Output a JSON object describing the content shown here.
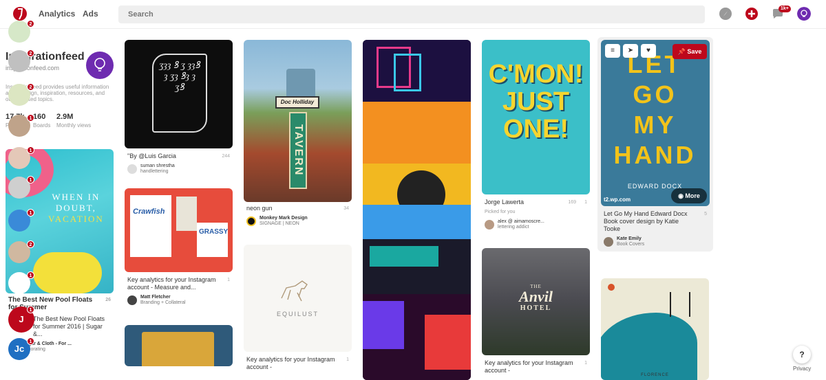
{
  "topbar": {
    "nav": [
      "Analytics",
      "Ads"
    ],
    "search_placeholder": "Search",
    "messages_badge": "1k+"
  },
  "profile": {
    "name": "Inspirationfeed",
    "url": "inspirationfeed.com",
    "description": "Inspirationfeed provides useful information about design, inspiration, resources, and other related topics.",
    "stats": [
      {
        "value": "17.7k",
        "label": "Pins"
      },
      {
        "value": "160",
        "label": "Boards"
      },
      {
        "value": "2.9M",
        "label": "Monthly views"
      }
    ]
  },
  "notifications": [
    {
      "badge": "2"
    },
    {
      "badge": "2"
    },
    {
      "badge": "2"
    },
    {
      "badge": "1"
    },
    {
      "badge": "1"
    },
    {
      "badge": "1"
    },
    {
      "badge": "1"
    },
    {
      "badge": "2"
    },
    {
      "badge": "1"
    },
    {
      "badge": "1",
      "letter": "J"
    },
    {
      "badge": "1",
      "letter": "Jc"
    }
  ],
  "pins": {
    "col0": [
      {
        "title": "The Best New Pool Floats for Summer",
        "repins": "26",
        "desc": "The Best New Pool Floats for Summer 2016 | Sugar &...",
        "user": "Sugar & Cloth - For ...",
        "board": "Decorating"
      }
    ],
    "col1": [
      {
        "title": "\"By @Luis Garcia",
        "repins": "244",
        "user": "suman shrestha",
        "board": "handlettering"
      },
      {
        "title": "Key analytics for your Instagram account - Measure and...",
        "repins": "1",
        "user": "Matt Fletcher",
        "board": "Branding + Collateral"
      }
    ],
    "col2": [
      {
        "title": "neon gun",
        "repins": "34",
        "user": "Monkey Mark Design",
        "board": "SIGNAGE | NEON",
        "sign_top": "Doc Holliday",
        "sign_main": "TAVERN"
      },
      {
        "title": "Key analytics for your Instagram account -",
        "repins": "1",
        "img_text": "EQUILUST"
      }
    ],
    "col3": [
      {
        "title": ""
      }
    ],
    "col4": [
      {
        "title": "Jorge Lawerta",
        "repins": "169",
        "likes": "1",
        "sub": "Picked for you",
        "user": "alex @ aimamoscre...",
        "board": "lettering addict",
        "img_lines": [
          "C'MON!",
          "JUST",
          "ONE!"
        ]
      },
      {
        "title": "Key analytics for your Instagram account -",
        "repins": "1",
        "img_small": "THE",
        "img_big": "Anvil",
        "img_sub": "HOTEL"
      }
    ],
    "col5": [
      {
        "title": "Let Go My Hand Edward Docx Book cover design by Katie Tooke",
        "repins": "5",
        "user": "Kate Emily",
        "board": "Book Covers",
        "domain": "t2.wp.com",
        "save": "Save",
        "more": "More",
        "img_lines": [
          "LET",
          "GO",
          "MY",
          "HAND"
        ],
        "author": "EDWARD DOCX"
      },
      {
        "title": "",
        "img_text": "FLORENCE"
      }
    ]
  },
  "help": {
    "label": "?",
    "privacy": "Privacy"
  },
  "colors": {
    "brand": "#bd081c",
    "purple": "#6e2bb0"
  }
}
